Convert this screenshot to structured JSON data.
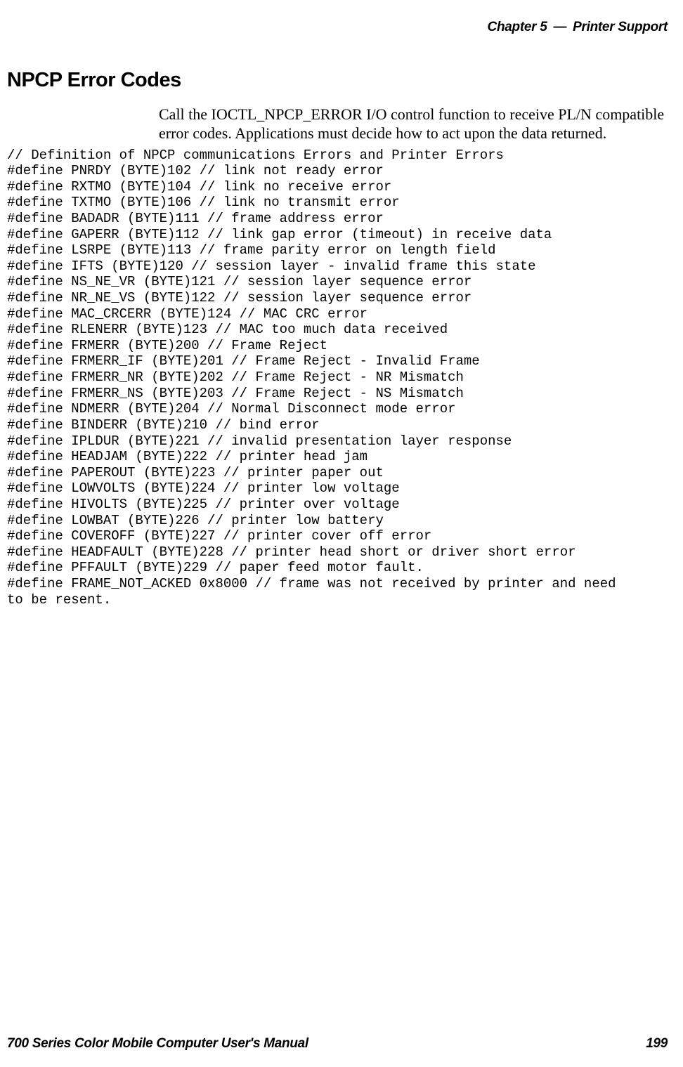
{
  "header": {
    "chapter": "Chapter 5",
    "dash": "—",
    "title": "Printer Support"
  },
  "section": {
    "title": "NPCP Error Codes",
    "paragraph": "Call the IOCTL_NPCP_ERROR I/O control function to receive PL/N compatible error codes. Applications must decide how to act upon the data returned."
  },
  "code": "// Definition of NPCP communications Errors and Printer Errors\n#define PNRDY (BYTE)102 // link not ready error\n#define RXTMO (BYTE)104 // link no receive error\n#define TXTMO (BYTE)106 // link no transmit error\n#define BADADR (BYTE)111 // frame address error\n#define GAPERR (BYTE)112 // link gap error (timeout) in receive data\n#define LSRPE (BYTE)113 // frame parity error on length field\n#define IFTS (BYTE)120 // session layer - invalid frame this state\n#define NS_NE_VR (BYTE)121 // session layer sequence error\n#define NR_NE_VS (BYTE)122 // session layer sequence error\n#define MAC_CRCERR (BYTE)124 // MAC CRC error\n#define RLENERR (BYTE)123 // MAC too much data received\n#define FRMERR (BYTE)200 // Frame Reject\n#define FRMERR_IF (BYTE)201 // Frame Reject - Invalid Frame\n#define FRMERR_NR (BYTE)202 // Frame Reject - NR Mismatch\n#define FRMERR_NS (BYTE)203 // Frame Reject - NS Mismatch\n#define NDMERR (BYTE)204 // Normal Disconnect mode error\n#define BINDERR (BYTE)210 // bind error\n#define IPLDUR (BYTE)221 // invalid presentation layer response\n#define HEADJAM (BYTE)222 // printer head jam\n#define PAPEROUT (BYTE)223 // printer paper out\n#define LOWVOLTS (BYTE)224 // printer low voltage\n#define HIVOLTS (BYTE)225 // printer over voltage\n#define LOWBAT (BYTE)226 // printer low battery\n#define COVEROFF (BYTE)227 // printer cover off error\n#define HEADFAULT (BYTE)228 // printer head short or driver short error\n#define PFFAULT (BYTE)229 // paper feed motor fault.\n#define FRAME_NOT_ACKED 0x8000 // frame was not received by printer and need\nto be resent.",
  "footer": {
    "manual": "700 Series Color Mobile Computer User's Manual",
    "page": "199"
  }
}
